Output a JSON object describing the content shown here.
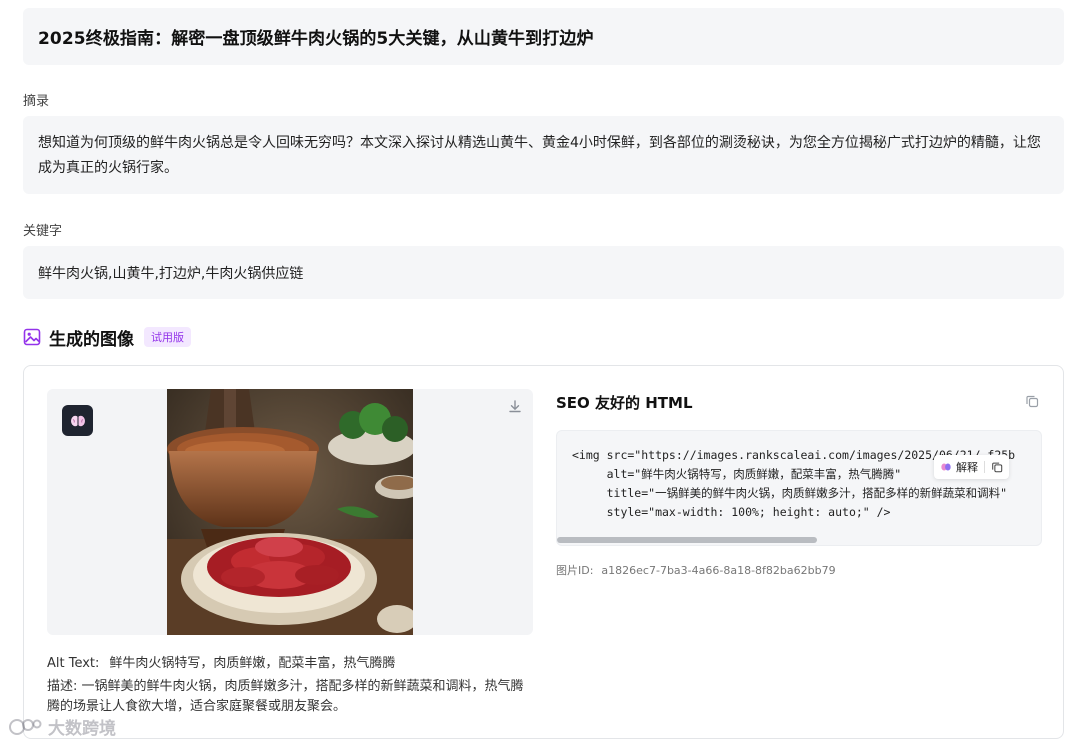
{
  "article": {
    "title": "2025终极指南：解密一盘顶级鲜牛肉火锅的5大关键，从山黄牛到打边炉",
    "abstract_label": "摘录",
    "abstract": "想知道为何顶级的鲜牛肉火锅总是令人回味无穷吗？本文深入探讨从精选山黄牛、黄金4小时保鲜，到各部位的涮烫秘诀，为您全方位揭秘广式打边炉的精髓，让您成为真正的火锅行家。",
    "keywords_label": "关键字",
    "keywords": "鲜牛肉火锅,山黄牛,打边炉,牛肉火锅供应链"
  },
  "generated": {
    "section_title": "生成的图像",
    "badge": "试用版",
    "alt_label": "Alt Text:",
    "alt_value": "鲜牛肉火锅特写，肉质鲜嫩，配菜丰富，热气腾腾",
    "desc_label": "描述:",
    "desc_value": "一锅鲜美的鲜牛肉火锅，肉质鲜嫩多汁，搭配多样的新鲜蔬菜和调料，热气腾腾的场景让人食欲大增，适合家庭聚餐或朋友聚会。",
    "seo_title": "SEO 友好的 HTML",
    "code_lines": [
      "<img src=\"https://images.rankscaleai.com/images/2025/06/21/…f25b",
      "     alt=\"鲜牛肉火锅特写，肉质鲜嫩，配菜丰富，热气腾腾\"",
      "     title=\"一锅鲜美的鲜牛肉火锅，肉质鲜嫩多汁，搭配多样的新鲜蔬菜和调料\"",
      "     style=\"max-width: 100%; height: auto;\" />"
    ],
    "explain_label": "解释",
    "image_id_label": "图片ID:",
    "image_id": "a1826ec7-7ba3-4a66-8a18-8f82ba62bb79"
  },
  "icons": {
    "section": "image-icon",
    "brain": "brain-icon",
    "download": "download-icon",
    "copy": "copy-icon"
  },
  "colors": {
    "accent": "#9333ea",
    "badge_bg": "#f3e8ff",
    "box_bg": "#f5f6f8"
  },
  "watermark": "大数跨境"
}
